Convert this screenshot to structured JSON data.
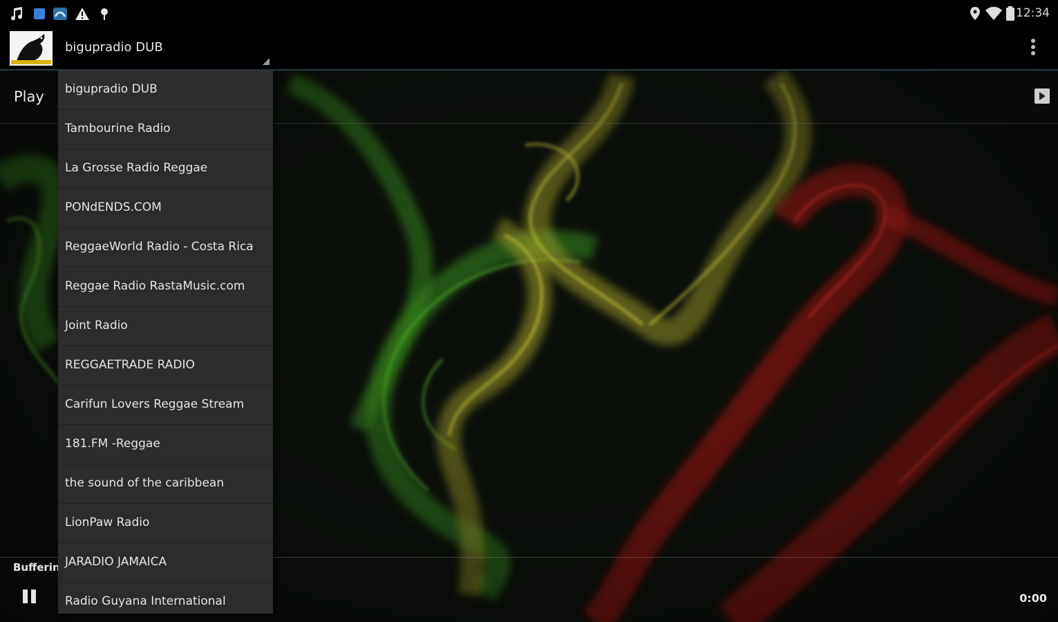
{
  "status_bar": {
    "time": "12:34",
    "left_icons": [
      "music-note-icon",
      "blue-square-icon",
      "photo-icon",
      "warning-icon",
      "pin-icon"
    ],
    "right_icons": [
      "location-icon",
      "wifi-icon",
      "battery-icon"
    ]
  },
  "action_bar": {
    "selected_station": "bigupradio DUB",
    "logo_icon": "crow-logo-icon",
    "overflow_icon": "overflow-menu-icon"
  },
  "main": {
    "play_label": "Play",
    "play_icon": "play-icon"
  },
  "dropdown": {
    "items": [
      {
        "label": "bigupradio DUB"
      },
      {
        "label": "Tambourine Radio"
      },
      {
        "label": "La Grosse Radio Reggae"
      },
      {
        "label": "PONdENDS.COM"
      },
      {
        "label": "ReggaeWorld Radio - Costa Rica"
      },
      {
        "label": "Reggae Radio RastaMusic.com"
      },
      {
        "label": "Joint Radio"
      },
      {
        "label": "REGGAETRADE RADIO"
      },
      {
        "label": "Carifun Lovers Reggae Stream"
      },
      {
        "label": "181.FM -Reggae"
      },
      {
        "label": "the sound of the caribbean"
      },
      {
        "label": "LionPaw Radio"
      },
      {
        "label": "JARADIO JAMAICA"
      },
      {
        "label": "Radio Guyana International"
      }
    ]
  },
  "player": {
    "status": "Buffering",
    "time": "0:00",
    "pause_icon": "pause-icon"
  },
  "colors": {
    "smoke_green": "#3e9a1e",
    "smoke_yellow": "#b9b52a",
    "smoke_red": "#c81818",
    "dropdown_bg": "#2c2c2c",
    "action_bar_divider": "#2a3a48"
  }
}
